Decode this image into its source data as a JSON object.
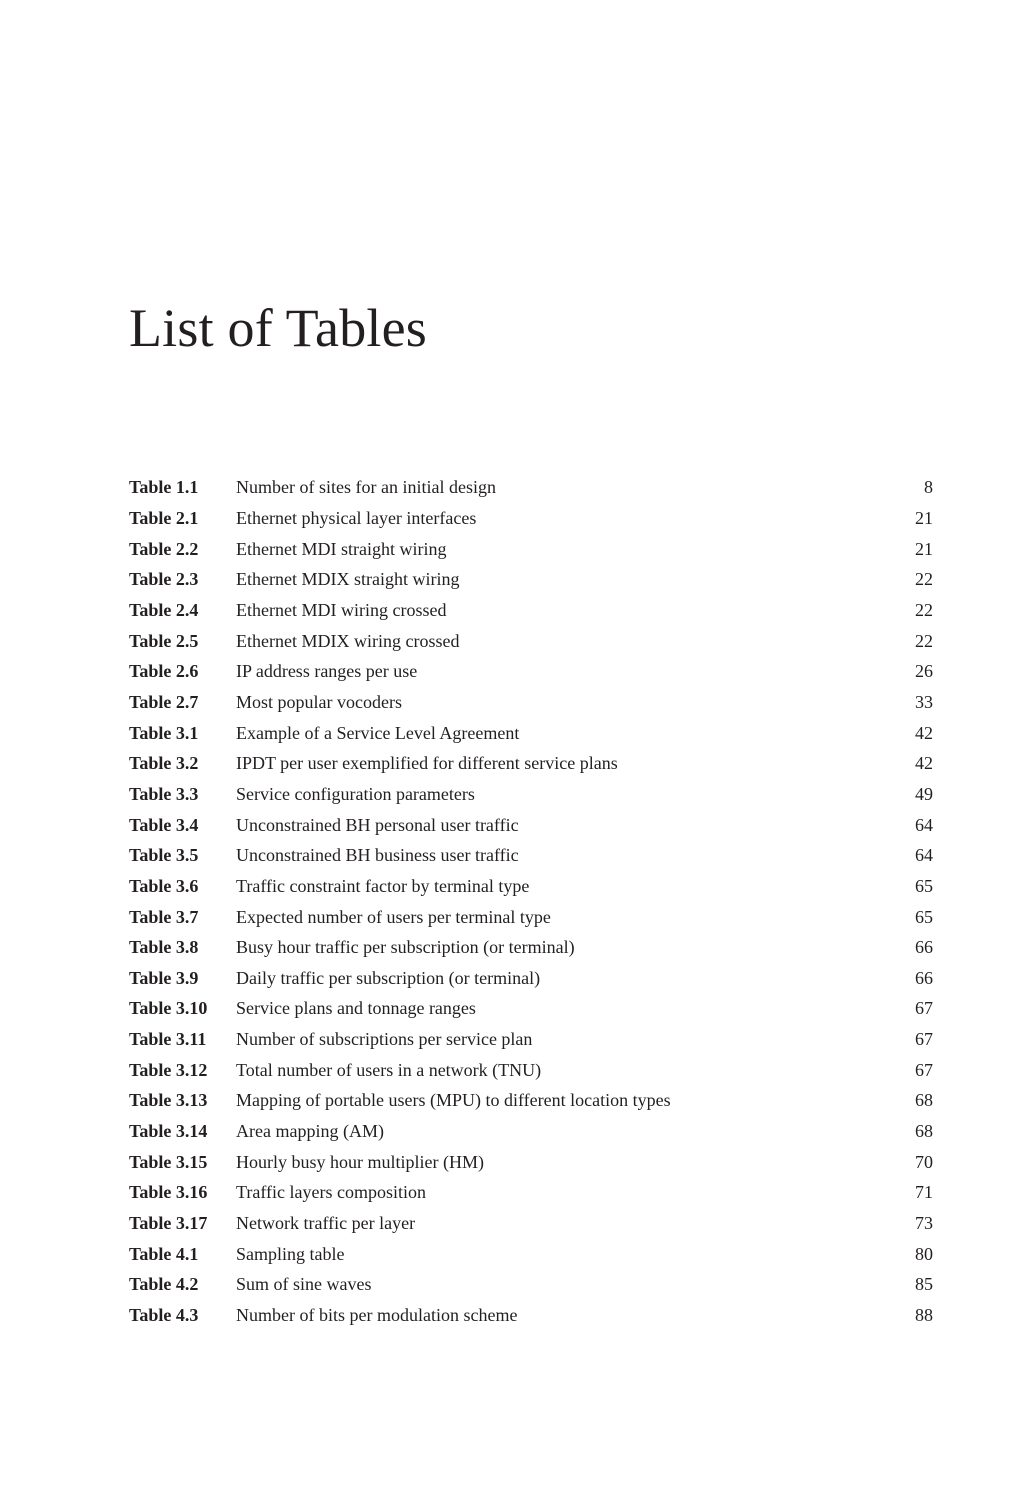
{
  "page": {
    "title": "List of Tables"
  },
  "entries": [
    {
      "label": "Table 1.1",
      "title": "Number of sites for an initial design",
      "page": "8"
    },
    {
      "label": "Table 2.1",
      "title": "Ethernet physical layer interfaces",
      "page": "21"
    },
    {
      "label": "Table 2.2",
      "title": "Ethernet MDI straight wiring",
      "page": "21"
    },
    {
      "label": "Table 2.3",
      "title": "Ethernet MDIX straight wiring",
      "page": "22"
    },
    {
      "label": "Table 2.4",
      "title": "Ethernet MDI wiring crossed",
      "page": "22"
    },
    {
      "label": "Table 2.5",
      "title": "Ethernet MDIX wiring crossed",
      "page": "22"
    },
    {
      "label": "Table 2.6",
      "title": "IP address ranges per use",
      "page": "26"
    },
    {
      "label": "Table 2.7",
      "title": "Most popular vocoders",
      "page": "33"
    },
    {
      "label": "Table 3.1",
      "title": "Example of a Service Level Agreement",
      "page": "42"
    },
    {
      "label": "Table 3.2",
      "title": "IPDT per user exemplified for different service plans",
      "page": "42"
    },
    {
      "label": "Table 3.3",
      "title": "Service configuration parameters",
      "page": "49"
    },
    {
      "label": "Table 3.4",
      "title": "Unconstrained BH personal user traffic",
      "page": "64"
    },
    {
      "label": "Table 3.5",
      "title": "Unconstrained BH business user traffic",
      "page": "64"
    },
    {
      "label": "Table 3.6",
      "title": "Traffic constraint factor by terminal type",
      "page": "65"
    },
    {
      "label": "Table 3.7",
      "title": "Expected number of users per terminal type",
      "page": "65"
    },
    {
      "label": "Table 3.8",
      "title": "Busy hour traffic per subscription (or terminal)",
      "page": "66"
    },
    {
      "label": "Table 3.9",
      "title": "Daily traffic per subscription (or terminal)",
      "page": "66"
    },
    {
      "label": "Table 3.10",
      "title": "Service plans and tonnage ranges",
      "page": "67"
    },
    {
      "label": "Table 3.11",
      "title": "Number of subscriptions per service plan",
      "page": "67"
    },
    {
      "label": "Table 3.12",
      "title": "Total number of users in a network (TNU)",
      "page": "67"
    },
    {
      "label": "Table 3.13",
      "title": "Mapping of portable users (MPU) to different location types",
      "page": "68"
    },
    {
      "label": "Table 3.14",
      "title": "Area mapping (AM)",
      "page": "68"
    },
    {
      "label": "Table 3.15",
      "title": "Hourly busy hour multiplier (HM)",
      "page": "70"
    },
    {
      "label": "Table 3.16",
      "title": "Traffic layers composition",
      "page": "71"
    },
    {
      "label": "Table 3.17",
      "title": "Network traffic per layer",
      "page": "73"
    },
    {
      "label": "Table 4.1",
      "title": "Sampling table",
      "page": "80"
    },
    {
      "label": "Table 4.2",
      "title": "Sum of sine waves",
      "page": "85"
    },
    {
      "label": "Table 4.3",
      "title": "Number of bits per modulation scheme",
      "page": "88"
    }
  ]
}
